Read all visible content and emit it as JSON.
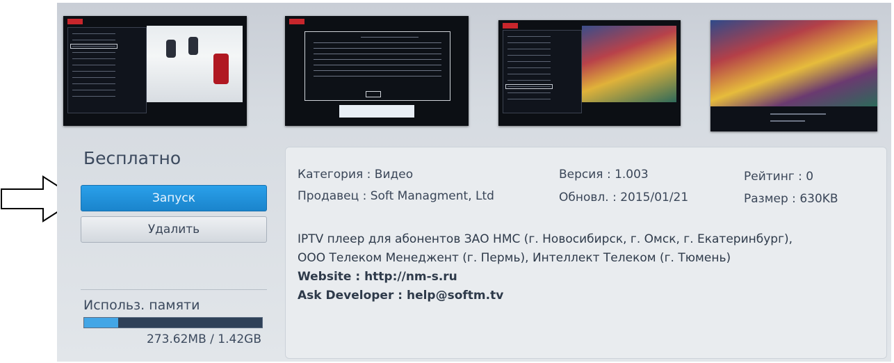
{
  "app": {
    "price": "Бесплатно",
    "launch_label": "Запуск",
    "delete_label": "Удалить"
  },
  "memory": {
    "label": "Использ. памяти",
    "value": "273.62MB / 1.42GB",
    "fraction": 0.19
  },
  "details": {
    "category": "Категория : Видео",
    "seller": "Продавец : Soft Managment, Ltd",
    "version": "Версия : 1.003",
    "updated": "Обновл. : 2015/01/21",
    "rating": "Рейтинг : 0",
    "size": "Размер : 630KB"
  },
  "description": {
    "line1": "IPTV плеер для абонентов ЗАО НМС (г. Новосибирск, г. Омск, г. Екатеринбург),",
    "line2": "ООО Телеком Менеджент (г. Пермь), Интеллект Телеком (г. Тюмень)",
    "website": "Website : http://nm-s.ru",
    "developer": "Ask Developer : help@softm.tv"
  },
  "colors": {
    "accent": "#1a84cc",
    "memory_fill": "#43a6e6",
    "memory_track": "#2f4158"
  },
  "icons": {
    "pointer": "right-arrow-outline-icon"
  }
}
